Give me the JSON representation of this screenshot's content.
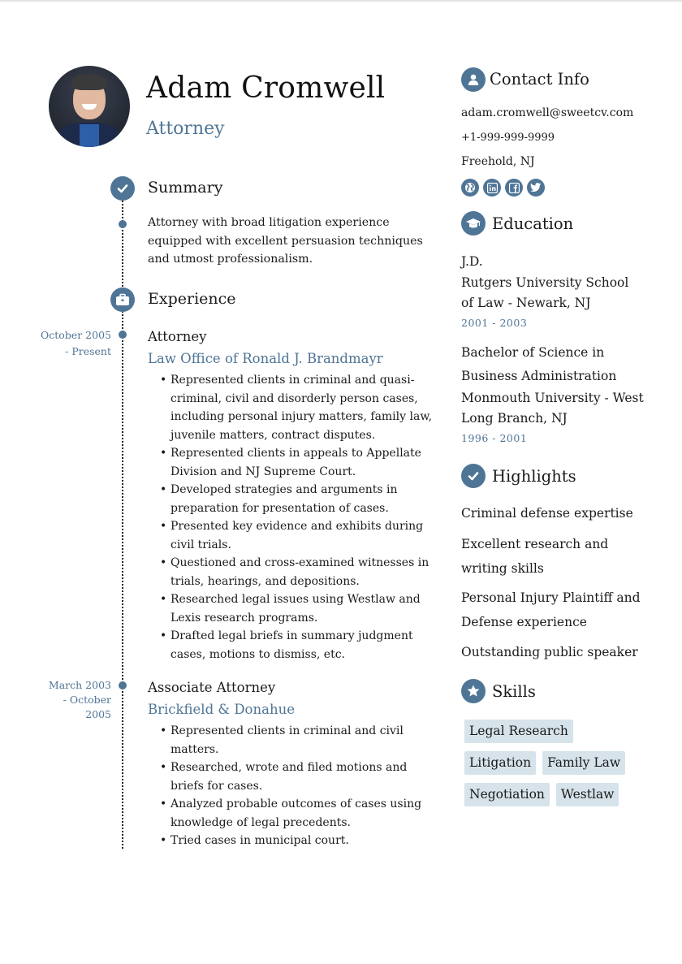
{
  "header": {
    "name": "Adam Cromwell",
    "title": "Attorney"
  },
  "summary": {
    "heading": "Summary",
    "text": "Attorney with broad litigation experience equipped with excellent persuasion techniques and utmost professionalism."
  },
  "experience": {
    "heading": "Experience",
    "jobs": [
      {
        "date_start": "October 2005",
        "date_end": "- Present",
        "role": "Attorney",
        "company": "Law Office of Ronald J. Brandmayr",
        "bullets": [
          "Represented clients in criminal and quasi-criminal, civil and disorderly person cases, including personal injury matters, family law, juvenile matters, contract disputes.",
          "Represented clients in appeals to Appellate Division and NJ Supreme Court.",
          "Developed strategies and arguments in preparation for presentation of cases.",
          "Presented key evidence and exhibits during civil trials.",
          "Questioned and cross-examined witnesses in trials, hearings, and depositions.",
          "Researched legal issues using Westlaw and Lexis research programs.",
          "Drafted legal briefs in summary judgment cases, motions to dismiss, etc."
        ]
      },
      {
        "date_start": "March 2003",
        "date_end": "- October 2005",
        "role": "Associate Attorney",
        "company": "Brickfield & Donahue",
        "bullets": [
          "Represented clients in criminal and civil matters.",
          "Researched, wrote and filed motions and briefs for cases.",
          "Analyzed probable outcomes of cases using knowledge of legal precedents.",
          "Tried cases in municipal court."
        ]
      }
    ]
  },
  "contact": {
    "heading": "Contact Info",
    "email": "adam.cromwell@sweetcv.com",
    "phone": "+1-999-999-9999",
    "location": "Freehold, NJ",
    "social_icons": [
      "globe-icon",
      "linkedin-icon",
      "facebook-icon",
      "twitter-icon"
    ]
  },
  "education": {
    "heading": "Education",
    "items": [
      {
        "degree": "J.D.",
        "school": "Rutgers University School of Law - Newark, NJ",
        "dates": "2001 - 2003"
      },
      {
        "degree": "Bachelor of Science in Business Administration",
        "school": "Monmouth University - West Long Branch, NJ",
        "dates": "1996 - 2001"
      }
    ]
  },
  "highlights": {
    "heading": "Highlights",
    "items": [
      "Criminal defense expertise",
      "Excellent research and writing skills",
      "Personal Injury Plaintiff and Defense experience",
      "Outstanding public speaker"
    ]
  },
  "skills": {
    "heading": "Skills",
    "items": [
      "Legal Research",
      "Litigation",
      "Family Law",
      "Negotiation",
      "Westlaw"
    ]
  },
  "colors": {
    "accent": "#4f7596",
    "skill_tag_bg": "#d6e3ea",
    "text": "#1a1a1a"
  }
}
